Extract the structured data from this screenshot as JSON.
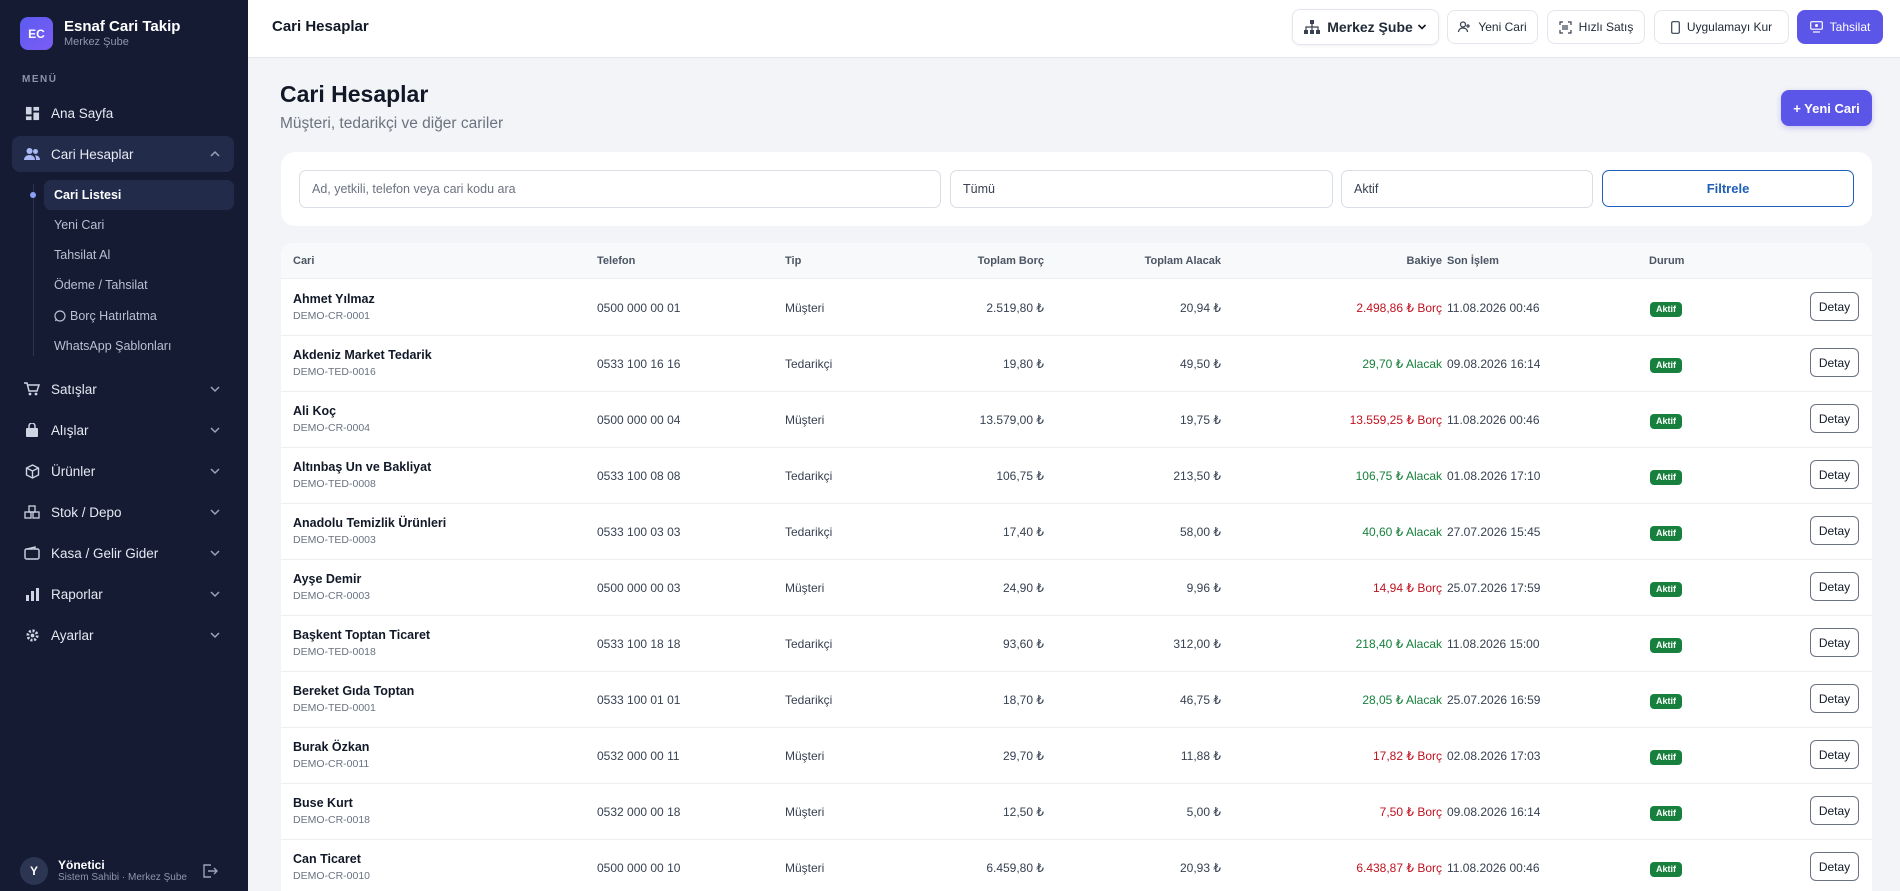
{
  "app": {
    "initials": "EC",
    "name": "Esnaf Cari Takip",
    "branch": "Merkez Şube"
  },
  "sidebar": {
    "menu_title": "MENÜ",
    "home": "Ana Sayfa",
    "accounts": "Cari Hesaplar",
    "sub": [
      "Cari Listesi",
      "Yeni Cari",
      "Tahsilat Al",
      "Ödeme / Tahsilat",
      "Borç Hatırlatma",
      "WhatsApp Şablonları"
    ],
    "items": [
      "Satışlar",
      "Alışlar",
      "Ürünler",
      "Stok / Depo",
      "Kasa / Gelir Gider",
      "Raporlar",
      "Ayarlar"
    ]
  },
  "user": {
    "initial": "Y",
    "name": "Yönetici",
    "role": "Sistem Sahibi · Merkez Şube"
  },
  "topbar": {
    "title": "Cari Hesaplar",
    "branch_select": "Merkez Şube",
    "new_account": "Yeni Cari",
    "quick_sale": "Hızlı Satış",
    "install_app": "Uygulamayı Kur",
    "collection": "Tahsilat"
  },
  "page": {
    "title": "Cari Hesaplar",
    "subtitle": "Müşteri, tedarikçi ve diğer cariler",
    "new_button": "+ Yeni Cari"
  },
  "filters": {
    "search_placeholder": "Ad, yetkili, telefon veya cari kodu ara",
    "type_value": "Tümü",
    "status_value": "Aktif",
    "filter_button": "Filtrele"
  },
  "table": {
    "headers": {
      "cari": "Cari",
      "phone": "Telefon",
      "type": "Tip",
      "debt": "Toplam Borç",
      "credit": "Toplam Alacak",
      "balance": "Bakiye",
      "last": "Son İşlem",
      "status": "Durum"
    },
    "detail_label": "Detay",
    "rows": [
      {
        "name": "Ahmet Yılmaz",
        "code": "DEMO-CR-0001",
        "phone": "0500 000 00 01",
        "type": "Müşteri",
        "debt": "2.519,80 ₺",
        "credit": "20,94 ₺",
        "balance": "2.498,86 ₺ Borç",
        "kind": "debt",
        "last": "11.08.2026 00:46",
        "status": "Aktif"
      },
      {
        "name": "Akdeniz Market Tedarik",
        "code": "DEMO-TED-0016",
        "phone": "0533 100 16 16",
        "type": "Tedarikçi",
        "debt": "19,80 ₺",
        "credit": "49,50 ₺",
        "balance": "29,70 ₺ Alacak",
        "kind": "credit",
        "last": "09.08.2026 16:14",
        "status": "Aktif"
      },
      {
        "name": "Ali Koç",
        "code": "DEMO-CR-0004",
        "phone": "0500 000 00 04",
        "type": "Müşteri",
        "debt": "13.579,00 ₺",
        "credit": "19,75 ₺",
        "balance": "13.559,25 ₺ Borç",
        "kind": "debt",
        "last": "11.08.2026 00:46",
        "status": "Aktif"
      },
      {
        "name": "Altınbaş Un ve Bakliyat",
        "code": "DEMO-TED-0008",
        "phone": "0533 100 08 08",
        "type": "Tedarikçi",
        "debt": "106,75 ₺",
        "credit": "213,50 ₺",
        "balance": "106,75 ₺ Alacak",
        "kind": "credit",
        "last": "01.08.2026 17:10",
        "status": "Aktif"
      },
      {
        "name": "Anadolu Temizlik Ürünleri",
        "code": "DEMO-TED-0003",
        "phone": "0533 100 03 03",
        "type": "Tedarikçi",
        "debt": "17,40 ₺",
        "credit": "58,00 ₺",
        "balance": "40,60 ₺ Alacak",
        "kind": "credit",
        "last": "27.07.2026 15:45",
        "status": "Aktif"
      },
      {
        "name": "Ayşe Demir",
        "code": "DEMO-CR-0003",
        "phone": "0500 000 00 03",
        "type": "Müşteri",
        "debt": "24,90 ₺",
        "credit": "9,96 ₺",
        "balance": "14,94 ₺ Borç",
        "kind": "debt",
        "last": "25.07.2026 17:59",
        "status": "Aktif"
      },
      {
        "name": "Başkent Toptan Ticaret",
        "code": "DEMO-TED-0018",
        "phone": "0533 100 18 18",
        "type": "Tedarikçi",
        "debt": "93,60 ₺",
        "credit": "312,00 ₺",
        "balance": "218,40 ₺ Alacak",
        "kind": "credit",
        "last": "11.08.2026 15:00",
        "status": "Aktif"
      },
      {
        "name": "Bereket Gıda Toptan",
        "code": "DEMO-TED-0001",
        "phone": "0533 100 01 01",
        "type": "Tedarikçi",
        "debt": "18,70 ₺",
        "credit": "46,75 ₺",
        "balance": "28,05 ₺ Alacak",
        "kind": "credit",
        "last": "25.07.2026 16:59",
        "status": "Aktif"
      },
      {
        "name": "Burak Özkan",
        "code": "DEMO-CR-0011",
        "phone": "0532 000 00 11",
        "type": "Müşteri",
        "debt": "29,70 ₺",
        "credit": "11,88 ₺",
        "balance": "17,82 ₺ Borç",
        "kind": "debt",
        "last": "02.08.2026 17:03",
        "status": "Aktif"
      },
      {
        "name": "Buse Kurt",
        "code": "DEMO-CR-0018",
        "phone": "0532 000 00 18",
        "type": "Müşteri",
        "debt": "12,50 ₺",
        "credit": "5,00 ₺",
        "balance": "7,50 ₺ Borç",
        "kind": "debt",
        "last": "09.08.2026 16:14",
        "status": "Aktif"
      },
      {
        "name": "Can Ticaret",
        "code": "DEMO-CR-0010",
        "phone": "0500 000 00 10",
        "type": "Müşteri",
        "debt": "6.459,80 ₺",
        "credit": "20,93 ₺",
        "balance": "6.438,87 ₺ Borç",
        "kind": "debt",
        "last": "11.08.2026 00:46",
        "status": "Aktif"
      }
    ]
  },
  "colors": {
    "primary": "#5b55e8",
    "sidebar": "#141b33",
    "debt": "#c1121f",
    "credit": "#17803d",
    "filter_border": "#1f5fb8"
  }
}
